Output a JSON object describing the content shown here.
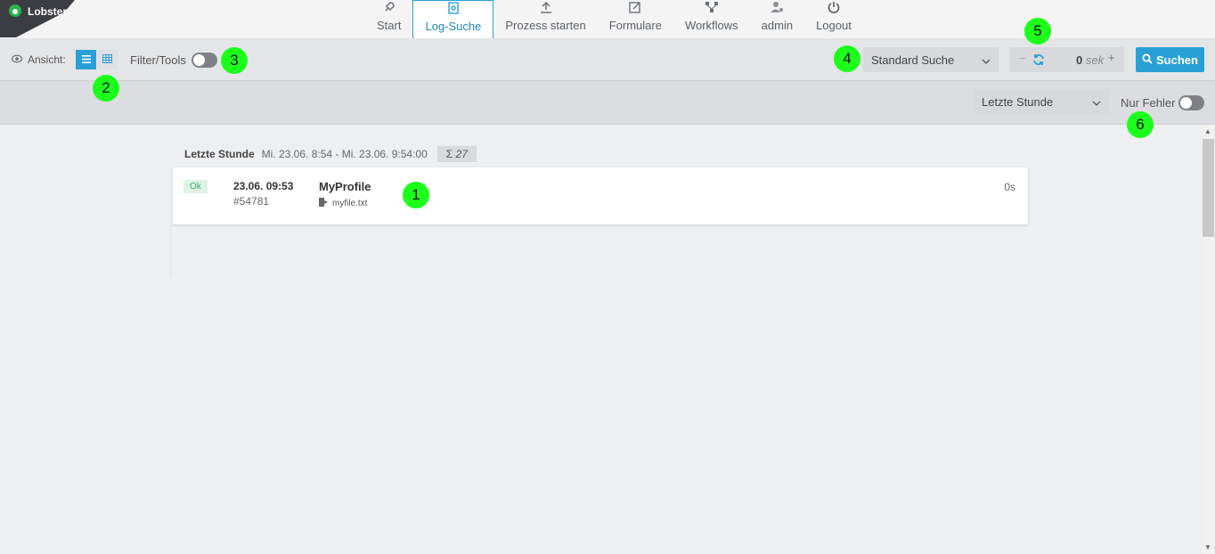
{
  "app": {
    "logo_text": "Lobster",
    "accent_color": "#2a9fd6"
  },
  "nav": {
    "items": [
      {
        "label": "Start",
        "icon": "rocket-icon"
      },
      {
        "label": "Log-Suche",
        "icon": "document-search-icon",
        "active": true
      },
      {
        "label": "Prozess starten",
        "icon": "upload-icon"
      },
      {
        "label": "Formulare",
        "icon": "edit-icon"
      },
      {
        "label": "Workflows",
        "icon": "workflow-icon"
      },
      {
        "label": "admin",
        "icon": "user-gear-icon"
      },
      {
        "label": "Logout",
        "icon": "power-icon"
      }
    ]
  },
  "toolbar": {
    "view_label": "Ansicht:",
    "filter_tools_label": "Filter/Tools",
    "search_preset": "Standard Suche",
    "refresh_value": "0",
    "refresh_unit": "sek",
    "minus": "−",
    "plus": "+",
    "search_label": "Suchen"
  },
  "filterbar": {
    "time_range": "Letzte Stunde",
    "errors_only_label": "Nur Fehler"
  },
  "results": {
    "group_title": "Letzte Stunde",
    "group_range": "Mi. 23.06. 8:54 - Mi. 23.06. 9:54:00",
    "count_symbol": "Σ",
    "count": "27",
    "entries": [
      {
        "status": "Ok",
        "date": "23.06. 09:53",
        "id": "#54781",
        "profile": "MyProfile",
        "file": "myfile.txt",
        "duration": "0s"
      }
    ]
  },
  "callouts": [
    "1",
    "2",
    "3",
    "4",
    "5",
    "6"
  ]
}
